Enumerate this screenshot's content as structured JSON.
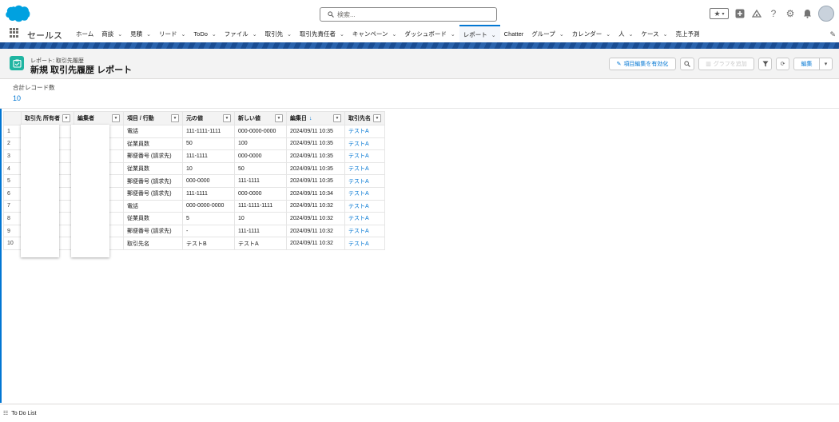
{
  "colors": {
    "brand_blue": "#0176d3",
    "header_blue": "#1a4d93",
    "report_icon": "#20b5a2",
    "logo_cloud": "#00a1e0"
  },
  "header": {
    "search_placeholder": "検索...",
    "icons": [
      "favorites-star-icon",
      "add-icon",
      "trailhead-icon",
      "help-icon",
      "setup-gear-icon",
      "notification-bell-icon",
      "user-avatar"
    ]
  },
  "nav": {
    "app_name": "セールス",
    "items": [
      {
        "label": "ホーム",
        "dropdown": false
      },
      {
        "label": "商談",
        "dropdown": true
      },
      {
        "label": "見積",
        "dropdown": true
      },
      {
        "label": "リード",
        "dropdown": true
      },
      {
        "label": "ToDo",
        "dropdown": true
      },
      {
        "label": "ファイル",
        "dropdown": true
      },
      {
        "label": "取引先",
        "dropdown": true
      },
      {
        "label": "取引先責任者",
        "dropdown": true
      },
      {
        "label": "キャンペーン",
        "dropdown": true
      },
      {
        "label": "ダッシュボード",
        "dropdown": true
      },
      {
        "label": "レポート",
        "dropdown": true,
        "active": true
      },
      {
        "label": "Chatter",
        "dropdown": false
      },
      {
        "label": "グループ",
        "dropdown": true
      },
      {
        "label": "カレンダー",
        "dropdown": true
      },
      {
        "label": "人",
        "dropdown": true
      },
      {
        "label": "ケース",
        "dropdown": true
      },
      {
        "label": "売上予測",
        "dropdown": false
      }
    ]
  },
  "report": {
    "breadcrumb": "レポート: 取引先履歴",
    "title": "新規 取引先履歴 レポート",
    "buttons": {
      "enable_field_edit": "項目編集を有効化",
      "add_chart": "グラフを追加",
      "edit": "編集"
    },
    "total_label": "合計レコード数",
    "total_value": "10",
    "columns": [
      "取引先 所有者",
      "編集者",
      "項目 / 行動",
      "元の値",
      "新しい値",
      "編集日",
      "取引先名"
    ],
    "sort_indicator": "↓",
    "rows": [
      {
        "n": "1",
        "owner": "",
        "editor": "",
        "field": "電話",
        "old": "111-1111-1111",
        "new": "000-0000-0000",
        "date": "2024/09/11 10:35",
        "account": "テストA"
      },
      {
        "n": "2",
        "owner": "",
        "editor": "",
        "field": "従業員数",
        "old": "50",
        "new": "100",
        "date": "2024/09/11 10:35",
        "account": "テストA"
      },
      {
        "n": "3",
        "owner": "",
        "editor": "",
        "field": "郵便番号 (請求先)",
        "old": "111-1111",
        "new": "000-0000",
        "date": "2024/09/11 10:35",
        "account": "テストA"
      },
      {
        "n": "4",
        "owner": "",
        "editor": "",
        "field": "従業員数",
        "old": "10",
        "new": "50",
        "date": "2024/09/11 10:35",
        "account": "テストA"
      },
      {
        "n": "5",
        "owner": "",
        "editor": "",
        "field": "郵便番号 (請求先)",
        "old": "000-0000",
        "new": "111-1111",
        "date": "2024/09/11 10:35",
        "account": "テストA"
      },
      {
        "n": "6",
        "owner": "",
        "editor": "",
        "field": "郵便番号 (請求先)",
        "old": "111-1111",
        "new": "000-0000",
        "date": "2024/09/11 10:34",
        "account": "テストA"
      },
      {
        "n": "7",
        "owner": "",
        "editor": "",
        "field": "電話",
        "old": "000-0000-0000",
        "new": "111-1111-1111",
        "date": "2024/09/11 10:32",
        "account": "テストA"
      },
      {
        "n": "8",
        "owner": "",
        "editor": "",
        "field": "従業員数",
        "old": "5",
        "new": "10",
        "date": "2024/09/11 10:32",
        "account": "テストA"
      },
      {
        "n": "9",
        "owner": "",
        "editor": "",
        "field": "郵便番号 (請求先)",
        "old": "-",
        "new": "111-1111",
        "date": "2024/09/11 10:32",
        "account": "テストA"
      },
      {
        "n": "10",
        "owner": "",
        "editor": "",
        "field": "取引先名",
        "old": "テストB",
        "new": "テストA",
        "date": "2024/09/11 10:32",
        "account": "テストA"
      }
    ]
  },
  "footer": {
    "todo_label": "To Do List"
  }
}
